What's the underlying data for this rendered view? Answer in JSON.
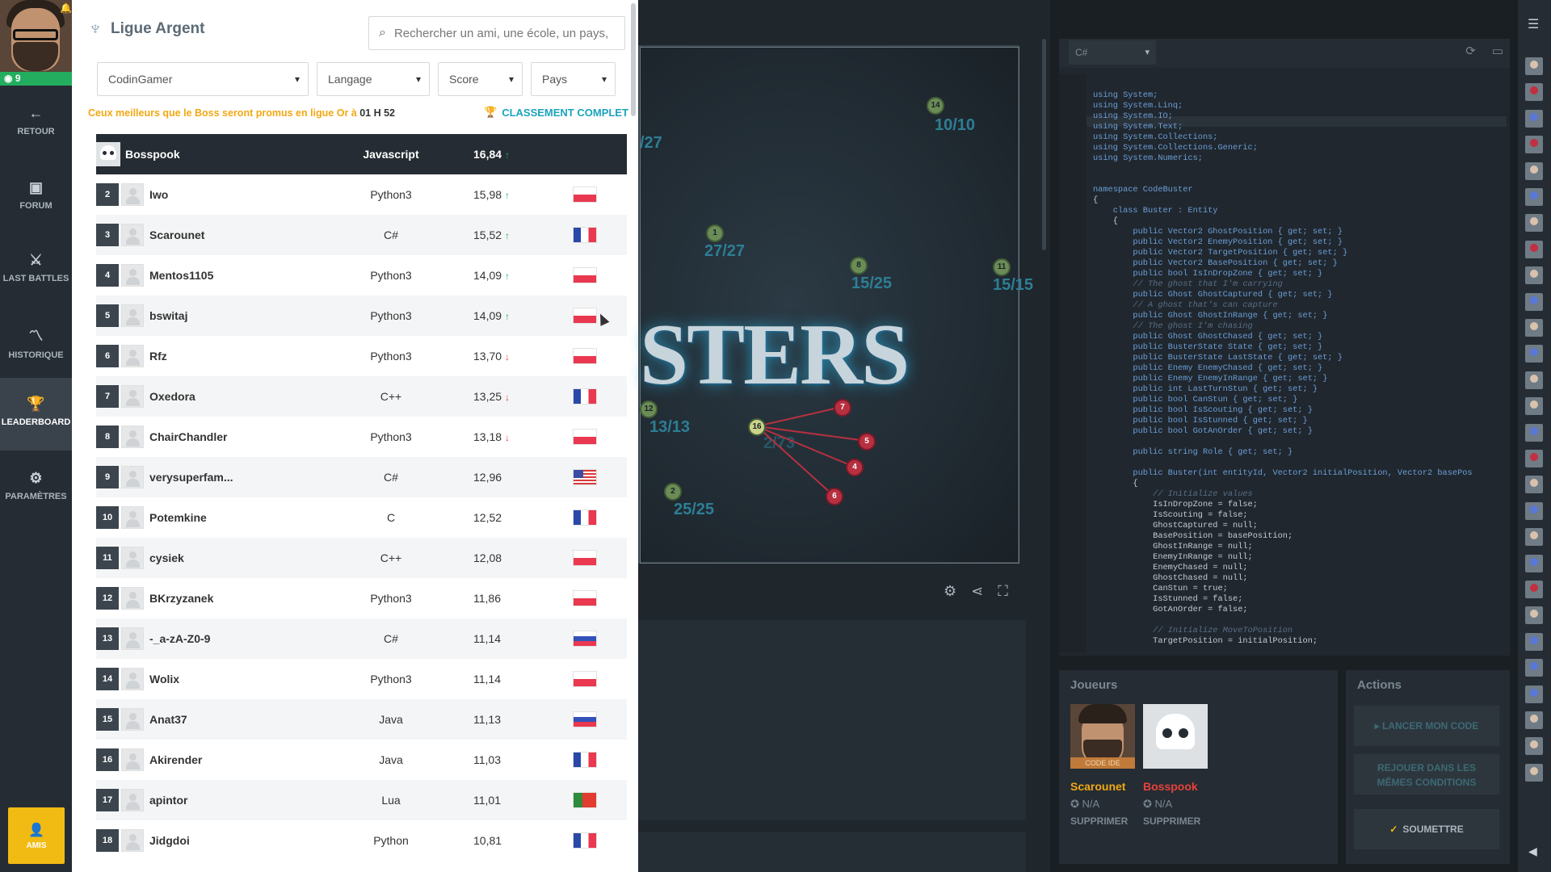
{
  "nav": {
    "level": "9",
    "items": [
      {
        "icon": "back-arrow-icon",
        "glyph": "←",
        "label": "RETOUR"
      },
      {
        "icon": "forum-icon",
        "glyph": "▣",
        "label": "FORUM"
      },
      {
        "icon": "battles-icon",
        "glyph": "⚔",
        "label": "LAST BATTLES"
      },
      {
        "icon": "history-icon",
        "glyph": "〽",
        "label": "HISTORIQUE"
      },
      {
        "icon": "trophy-icon",
        "glyph": "🏆",
        "label": "LEADERBOARD"
      },
      {
        "icon": "gear-icon",
        "glyph": "⚙",
        "label": "PARAMÈTRES"
      }
    ],
    "friends_label": "AMIS"
  },
  "leaderboard": {
    "league": "Ligue Argent",
    "search_placeholder": "Rechercher un ami, une école, un pays, ...",
    "filters": {
      "group": "CodinGamer",
      "language": "Langage",
      "score": "Score",
      "country": "Pays"
    },
    "promo_text": "Ceux meilleurs que le Boss seront promus en ligue Or à",
    "promo_time": "01 H 52",
    "full_ranking_label": "CLASSEMENT COMPLET",
    "boss": {
      "name": "Bosspook",
      "language": "Javascript",
      "score": "16,84",
      "trend": "up"
    },
    "rows": [
      {
        "rank": "2",
        "name": "Iwo",
        "language": "Python3",
        "score": "15,98",
        "trend": "up",
        "flag": "pl"
      },
      {
        "rank": "3",
        "name": "Scarounet",
        "language": "C#",
        "score": "15,52",
        "trend": "up",
        "flag": "fr"
      },
      {
        "rank": "4",
        "name": "Mentos1105",
        "language": "Python3",
        "score": "14,09",
        "trend": "up",
        "flag": "pl"
      },
      {
        "rank": "5",
        "name": "bswitaj",
        "language": "Python3",
        "score": "14,09",
        "trend": "up",
        "flag": "pl"
      },
      {
        "rank": "6",
        "name": "Rfz",
        "language": "Python3",
        "score": "13,70",
        "trend": "down",
        "flag": "pl"
      },
      {
        "rank": "7",
        "name": "Oxedora",
        "language": "C++",
        "score": "13,25",
        "trend": "down",
        "flag": "fr"
      },
      {
        "rank": "8",
        "name": "ChairChandler",
        "language": "Python3",
        "score": "13,18",
        "trend": "down",
        "flag": "pl"
      },
      {
        "rank": "9",
        "name": "verysuperfam...",
        "language": "C#",
        "score": "12,96",
        "trend": "",
        "flag": "us"
      },
      {
        "rank": "10",
        "name": "Potemkine",
        "language": "C",
        "score": "12,52",
        "trend": "",
        "flag": "fr"
      },
      {
        "rank": "11",
        "name": "cysiek",
        "language": "C++",
        "score": "12,08",
        "trend": "",
        "flag": "pl"
      },
      {
        "rank": "12",
        "name": "BKrzyzanek",
        "language": "Python3",
        "score": "11,86",
        "trend": "",
        "flag": "pl"
      },
      {
        "rank": "13",
        "name": "-_a-zA-Z0-9",
        "language": "C#",
        "score": "11,14",
        "trend": "",
        "flag": "ru"
      },
      {
        "rank": "14",
        "name": "Wolix",
        "language": "Python3",
        "score": "11,14",
        "trend": "",
        "flag": "pl"
      },
      {
        "rank": "15",
        "name": "Anat37",
        "language": "Java",
        "score": "11,13",
        "trend": "",
        "flag": "ru"
      },
      {
        "rank": "16",
        "name": "Akirender",
        "language": "Java",
        "score": "11,03",
        "trend": "",
        "flag": "fr"
      },
      {
        "rank": "17",
        "name": "apintor",
        "language": "Lua",
        "score": "11,01",
        "trend": "",
        "flag": "pt"
      },
      {
        "rank": "18",
        "name": "Jidgdoi",
        "language": "Python",
        "score": "10,81",
        "trend": "",
        "flag": "fr"
      }
    ]
  },
  "game": {
    "title_fragment": "STERS",
    "ghosts": [
      "14",
      "1",
      "8",
      "11",
      "12",
      "2"
    ],
    "ghost_labels": [
      "10/10",
      "/27",
      "27/27",
      "15/25",
      "15/15",
      "13/13",
      "25/25",
      "2/73"
    ],
    "busters": [
      "7",
      "5",
      "4",
      "6",
      "16"
    ]
  },
  "editor": {
    "language": "C#",
    "code_lines": [
      "using System;",
      "using System.Linq;",
      "using System.IO;",
      "using System.Text;",
      "using System.Collections;",
      "using System.Collections.Generic;",
      "using System.Numerics;",
      "",
      "",
      "namespace CodeBuster",
      "{",
      "    class Buster : Entity",
      "    {",
      "        public Vector2 GhostPosition { get; set; }",
      "        public Vector2 EnemyPosition { get; set; }",
      "        public Vector2 TargetPosition { get; set; }",
      "        public Vector2 BasePosition { get; set; }",
      "        public bool IsInDropZone { get; set; }",
      "        // The ghost that I'm carrying",
      "        public Ghost GhostCaptured { get; set; }",
      "        // A ghost that's can capture",
      "        public Ghost GhostInRange { get; set; }",
      "        // The ghost I'm chasing",
      "        public Ghost GhostChased { get; set; }",
      "        public BusterState State { get; set; }",
      "        public BusterState LastState { get; set; }",
      "        public Enemy EnemyChased { get; set; }",
      "        public Enemy EnemyInRange { get; set; }",
      "        public int LastTurnStun { get; set; }",
      "        public bool CanStun { get; set; }",
      "        public bool IsScouting { get; set; }",
      "        public bool IsStunned { get; set; }",
      "        public bool GotAnOrder { get; set; }",
      "",
      "        public string Role { get; set; }",
      "",
      "        public Buster(int entityId, Vector2 initialPosition, Vector2 basePos",
      "        {",
      "            // Initialize values",
      "            IsInDropZone = false;",
      "            IsScouting = false;",
      "            GhostCaptured = null;",
      "            BasePosition = basePosition;",
      "            GhostInRange = null;",
      "            EnemyInRange = null;",
      "            EnemyChased = null;",
      "            GhostChased = null;",
      "            CanStun = true;",
      "            IsStunned = false;",
      "            GotAnOrder = false;",
      "",
      "            // Initialize MoveToPosition",
      "            TargetPosition = initialPosition;"
    ]
  },
  "players": {
    "title": "Joueurs",
    "code_ide_label": "CODE IDE",
    "list": [
      {
        "name": "Scarounet",
        "rank": "N/A",
        "remove": "SUPPRIMER",
        "color": "#f2a813"
      },
      {
        "name": "Bosspook",
        "rank": "N/A",
        "remove": "SUPPRIMER",
        "color": "#e8413a"
      }
    ]
  },
  "actions": {
    "title": "Actions",
    "run": "LANCER MON CODE",
    "replay_line1": "REJOUER DANS LES",
    "replay_line2": "MÊMES CONDITIONS",
    "submit": "SOUMETTRE"
  }
}
